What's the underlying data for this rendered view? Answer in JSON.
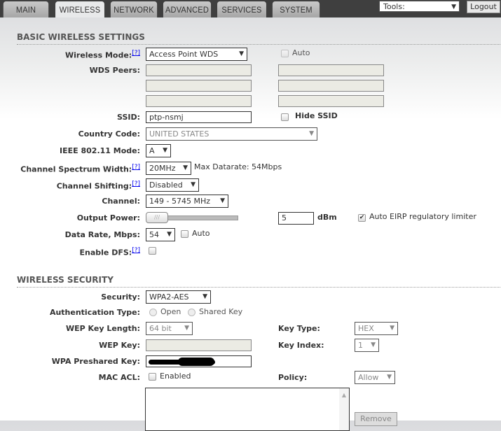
{
  "nav": {
    "tabs": [
      "MAIN",
      "WIRELESS",
      "NETWORK",
      "ADVANCED",
      "SERVICES",
      "SYSTEM"
    ],
    "active": "WIRELESS",
    "tools": "Tools:",
    "logout": "Logout"
  },
  "basic": {
    "title": "BASIC WIRELESS SETTINGS",
    "help": "[?]",
    "wireless_mode": {
      "label": "Wireless Mode:",
      "value": "Access Point WDS",
      "auto": "Auto"
    },
    "wds_peers": {
      "label": "WDS Peers:"
    },
    "ssid": {
      "label": "SSID:",
      "value": "ptp-nsmj",
      "hide": "Hide SSID"
    },
    "country": {
      "label": "Country Code:",
      "value": "UNITED STATES"
    },
    "ieee": {
      "label": "IEEE 802.11 Mode:",
      "value": "A"
    },
    "width": {
      "label": "Channel Spectrum Width:",
      "value": "20MHz",
      "max": "Max Datarate: 54Mbps"
    },
    "shifting": {
      "label": "Channel Shifting:",
      "value": "Disabled"
    },
    "channel": {
      "label": "Channel:",
      "value": "149 - 5745 MHz"
    },
    "power": {
      "label": "Output Power:",
      "value": "5",
      "unit": "dBm",
      "eirp": "Auto EIRP regulatory limiter"
    },
    "rate": {
      "label": "Data Rate, Mbps:",
      "value": "54",
      "auto": "Auto"
    },
    "dfs": {
      "label": "Enable DFS:"
    }
  },
  "security": {
    "title": "WIRELESS SECURITY",
    "security": {
      "label": "Security:",
      "value": "WPA2-AES"
    },
    "auth": {
      "label": "Authentication Type:",
      "open": "Open",
      "shared": "Shared Key"
    },
    "wep_len": {
      "label": "WEP Key Length:",
      "value": "64 bit"
    },
    "key_type": {
      "label": "Key Type:",
      "value": "HEX"
    },
    "wep_key": {
      "label": "WEP Key:"
    },
    "key_index": {
      "label": "Key Index:",
      "value": "1"
    },
    "wpa": {
      "label": "WPA Preshared Key:"
    },
    "mac_acl": {
      "label": "MAC ACL:",
      "enabled": "Enabled"
    },
    "policy": {
      "label": "Policy:",
      "value": "Allow"
    },
    "remove": "Remove"
  }
}
